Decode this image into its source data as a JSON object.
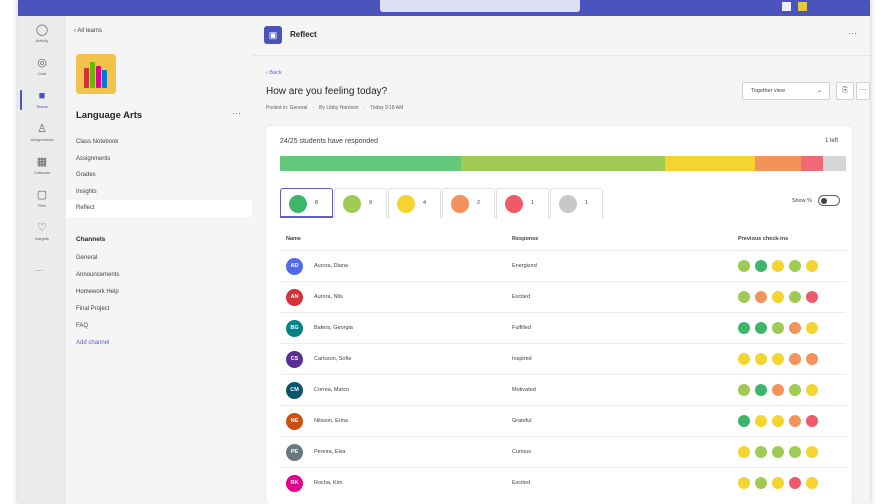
{
  "rail": [
    {
      "label": "Activity",
      "icon": "bell-icon"
    },
    {
      "label": "Chat",
      "icon": "chat-icon"
    },
    {
      "label": "Teams",
      "icon": "teams-icon",
      "active": true
    },
    {
      "label": "Assignments",
      "icon": "assignments-icon"
    },
    {
      "label": "Calendar",
      "icon": "calendar-icon"
    },
    {
      "label": "Files",
      "icon": "files-icon"
    },
    {
      "label": "Insights",
      "icon": "insights-icon"
    }
  ],
  "sidebar": {
    "back_label": "‹  All teams",
    "team_name": "Language Arts",
    "more": "···",
    "items": [
      "Class Notebook",
      "Assignments",
      "Grades",
      "Insights",
      "Reflect"
    ],
    "channels_header": "Channels",
    "channels": [
      "General",
      "Announcements",
      "Homework Help",
      "Final Project",
      "FAQ"
    ],
    "add_channel": "Add channel"
  },
  "header": {
    "app_title": "Reflect",
    "more": "···"
  },
  "main": {
    "back": "‹ Back",
    "question": "How are you feeling today?",
    "posted_in": "Posted in: General",
    "author": "By Libby Harrison",
    "time": "Today 9:18 AM",
    "view_select": "Together view",
    "responded": "24/25 students have responded",
    "left": "1 left",
    "show_pct": "Show %"
  },
  "distribution_colors": {
    "energized": "#64c87a",
    "good": "#9fcb54",
    "okay": "#f4d430",
    "down": "#f2935c",
    "bad": "#ef6a76",
    "none": "#d6d6d6"
  },
  "emoji_tabs": [
    {
      "icon": "energized-face-icon",
      "color": "#3fb56a",
      "count": "8"
    },
    {
      "icon": "good-face-icon",
      "color": "#9fcb54",
      "count": "9"
    },
    {
      "icon": "okay-face-icon",
      "color": "#f4d430",
      "count": "4"
    },
    {
      "icon": "down-face-icon",
      "color": "#f2935c",
      "count": "2"
    },
    {
      "icon": "bad-face-icon",
      "color": "#ef5a6a",
      "count": "1"
    },
    {
      "icon": "no-response-icon",
      "color": "#c8c8c8",
      "count": "1"
    }
  ],
  "table": {
    "headers": {
      "name": "Name",
      "response": "Response",
      "previous": "Previous check-ins"
    },
    "rows": [
      {
        "initials": "AD",
        "avatar": "#4f6bed",
        "name": "Aurora, Diana",
        "response": "Energized",
        "prev": [
          "#9fcb54",
          "#3fb56a",
          "#f4d430",
          "#9fcb54",
          "#f4d430"
        ]
      },
      {
        "initials": "AN",
        "avatar": "#d13438",
        "name": "Aurora, Nils",
        "response": "Excited",
        "prev": [
          "#9fcb54",
          "#f2935c",
          "#f4d430",
          "#9fcb54",
          "#ef5a6a"
        ]
      },
      {
        "initials": "BG",
        "avatar": "#038387",
        "name": "Bafera, Georgia",
        "response": "Fulfilled",
        "prev": [
          "#3fb56a",
          "#3fb56a",
          "#9fcb54",
          "#f2935c",
          "#f4d430"
        ]
      },
      {
        "initials": "CS",
        "avatar": "#5c2e91",
        "name": "Carlsson, Sofie",
        "response": "Inspired",
        "prev": [
          "#f4d430",
          "#f4d430",
          "#f4d430",
          "#f2935c",
          "#f2935c"
        ]
      },
      {
        "initials": "CM",
        "avatar": "#0b556a",
        "name": "Correa, Marco",
        "response": "Motivated",
        "prev": [
          "#9fcb54",
          "#3fb56a",
          "#f2935c",
          "#9fcb54",
          "#f4d430"
        ]
      },
      {
        "initials": "NE",
        "avatar": "#ca5010",
        "name": "Nilsson, Erina",
        "response": "Grateful",
        "prev": [
          "#3fb56a",
          "#f4d430",
          "#f4d430",
          "#f2935c",
          "#ef5a6a"
        ]
      },
      {
        "initials": "PE",
        "avatar": "#69797e",
        "name": "Pereira, Elsa",
        "response": "Curious",
        "prev": [
          "#f4d430",
          "#9fcb54",
          "#9fcb54",
          "#9fcb54",
          "#f4d430"
        ]
      },
      {
        "initials": "RK",
        "avatar": "#e3008c",
        "name": "Rocha, Kim",
        "response": "Excited",
        "prev": [
          "#f4d430",
          "#9fcb54",
          "#f4d430",
          "#ef5a6a",
          "#f4d430"
        ]
      }
    ]
  }
}
